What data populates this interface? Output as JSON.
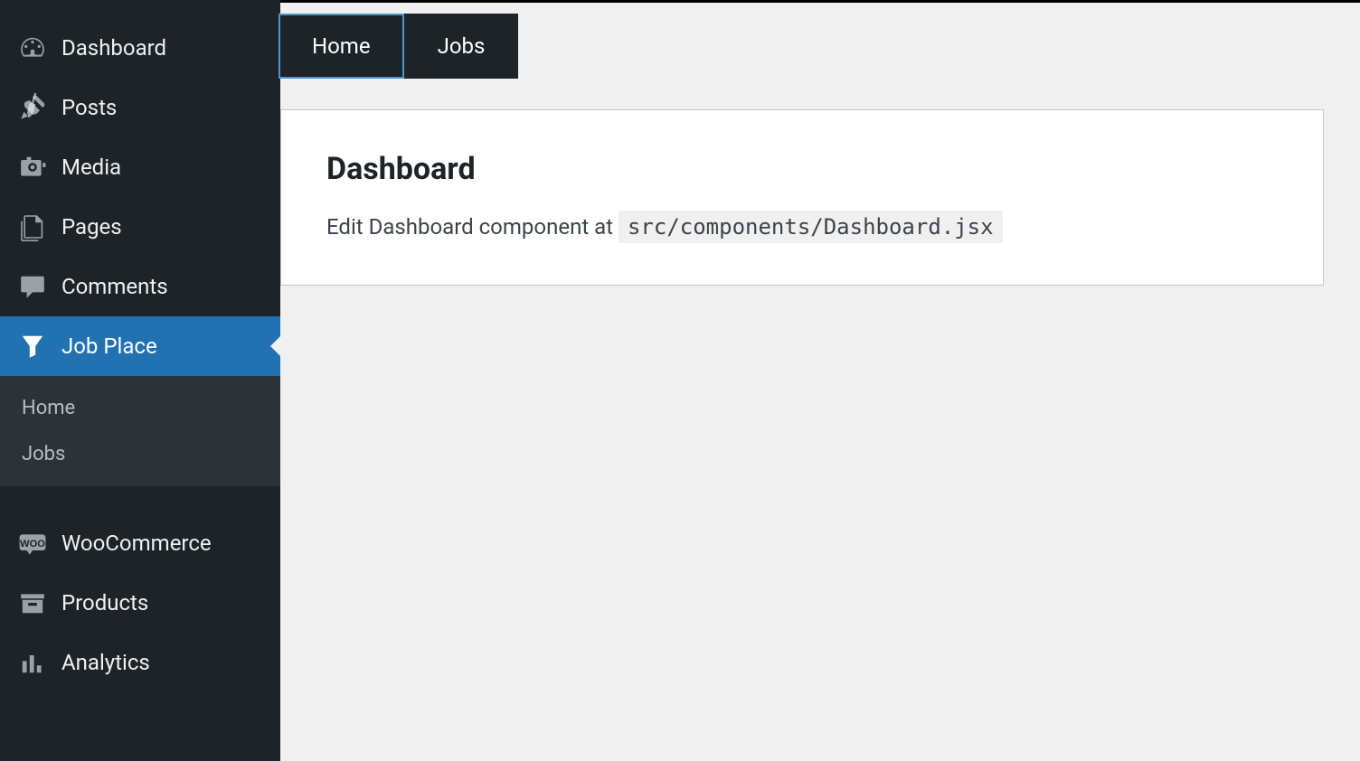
{
  "sidebar": {
    "items": [
      {
        "label": "Dashboard",
        "icon": "gauge-icon"
      },
      {
        "label": "Posts",
        "icon": "pin-icon"
      },
      {
        "label": "Media",
        "icon": "camera-icon"
      },
      {
        "label": "Pages",
        "icon": "page-icon"
      },
      {
        "label": "Comments",
        "icon": "comment-icon"
      },
      {
        "label": "Job Place",
        "icon": "funnel-icon",
        "active": true
      },
      {
        "label": "WooCommerce",
        "icon": "woo-icon"
      },
      {
        "label": "Products",
        "icon": "archive-icon"
      },
      {
        "label": "Analytics",
        "icon": "chart-icon"
      }
    ],
    "submenu": [
      {
        "label": "Home"
      },
      {
        "label": "Jobs"
      }
    ]
  },
  "tabs": [
    {
      "label": "Home",
      "active": true
    },
    {
      "label": "Jobs",
      "active": false
    }
  ],
  "panel": {
    "title": "Dashboard",
    "text_prefix": "Edit Dashboard component at ",
    "code_path": "src/components/Dashboard.jsx"
  }
}
